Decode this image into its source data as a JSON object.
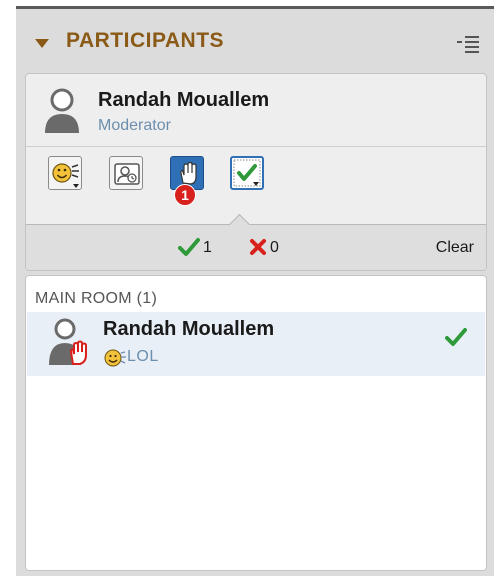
{
  "panel": {
    "title": "PARTICIPANTS",
    "accent_color": "#8a5a16",
    "icons": {
      "collapse": "triangle-down-icon",
      "options": "list-options-icon"
    }
  },
  "current_user": {
    "name": "Randah Mouallem",
    "role": "Moderator"
  },
  "toolbar": {
    "buttons": [
      {
        "name": "emoticon",
        "icon": "emoticon-icon"
      },
      {
        "name": "step-away",
        "icon": "step-away-icon"
      },
      {
        "name": "raise-hand",
        "icon": "raise-hand-icon",
        "badge": "1"
      },
      {
        "name": "yes-no",
        "icon": "checkmark-icon"
      }
    ]
  },
  "poll_summary": {
    "yes_count": "1",
    "no_count": "0",
    "clear_label": "Clear"
  },
  "room": {
    "title": "MAIN ROOM (1)",
    "participants": [
      {
        "name": "Randah Mouallem",
        "status": "LOL",
        "hand_raised": true,
        "answer": "yes"
      }
    ]
  }
}
